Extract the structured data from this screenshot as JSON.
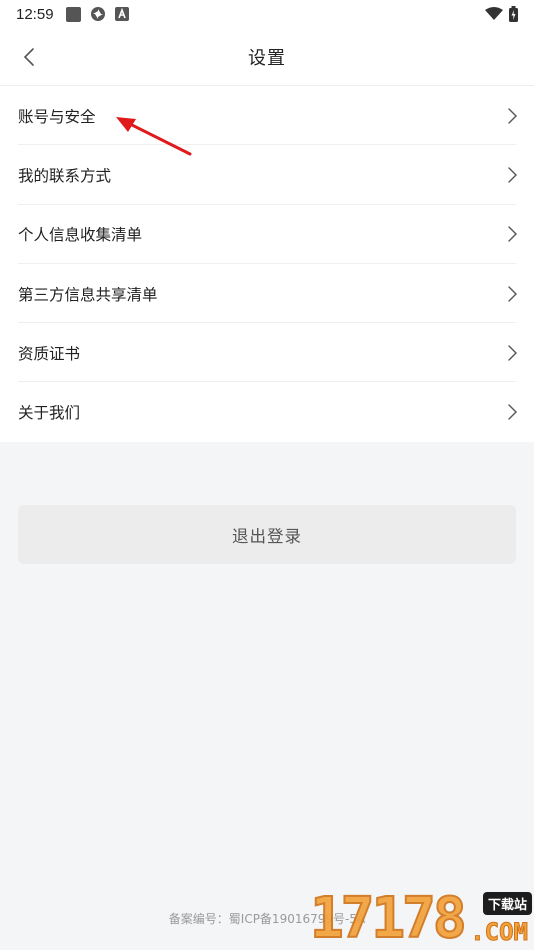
{
  "status_bar": {
    "time": "12:59",
    "icons": [
      "square-app-icon",
      "sync-app-icon",
      "a-app-icon",
      "wifi-icon",
      "battery-icon"
    ]
  },
  "header": {
    "title": "设置",
    "back_icon": "chevron-left-icon"
  },
  "menu": {
    "items": [
      {
        "label": "账号与安全"
      },
      {
        "label": "我的联系方式"
      },
      {
        "label": "个人信息收集清单"
      },
      {
        "label": "第三方信息共享清单"
      },
      {
        "label": "资质证书"
      },
      {
        "label": "关于我们"
      }
    ],
    "chevron_icon": "chevron-right-icon"
  },
  "logout": {
    "label": "退出登录"
  },
  "footer": {
    "icp": "备案编号：蜀ICP备19016799号-5A"
  },
  "watermark": {
    "digits": "17178",
    "badge": "下载站",
    "suffix": ".COM"
  },
  "colors": {
    "background": "#f3f5f6",
    "surface": "#ffffff",
    "text": "#222222",
    "annotation_arrow": "#e0191b",
    "logout_bg": "#ececec"
  }
}
